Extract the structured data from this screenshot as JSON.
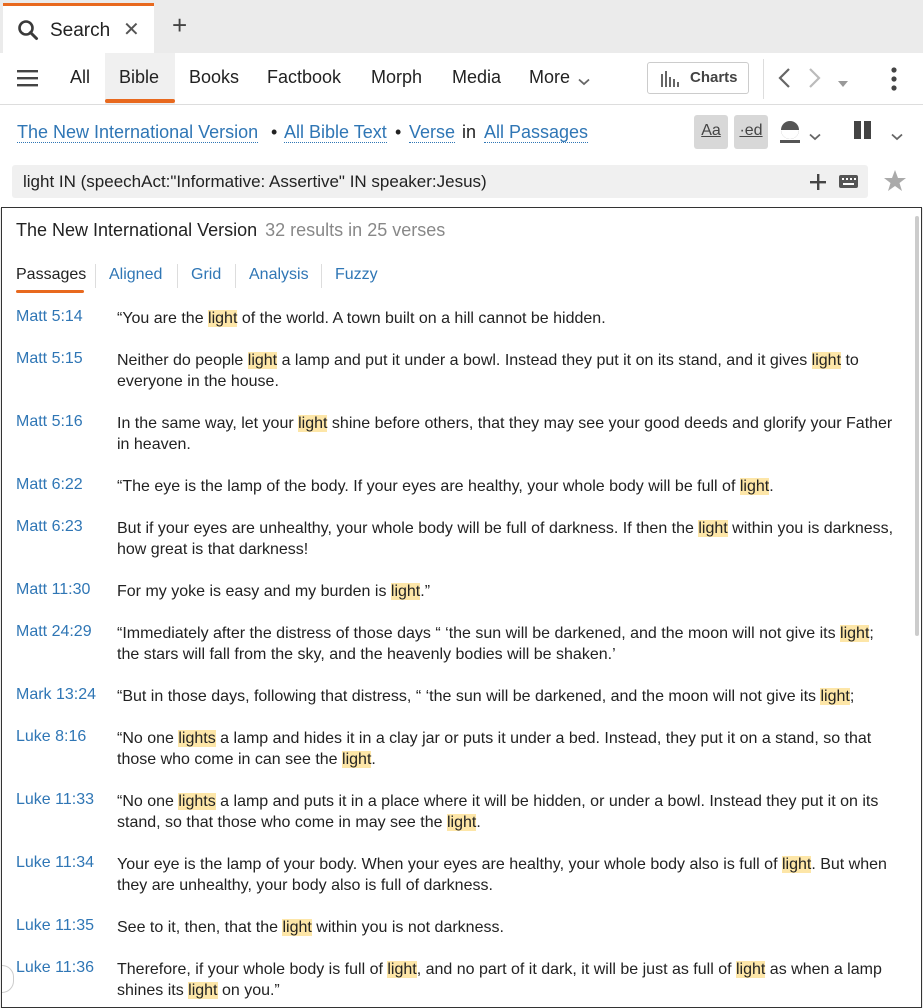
{
  "tab": {
    "label": "Search",
    "close": "✕",
    "new_tab": "+"
  },
  "toolbar": {
    "tabs": [
      "All",
      "Bible",
      "Books",
      "Factbook",
      "Morph",
      "Media",
      "More"
    ],
    "charts_label": "Charts"
  },
  "breadcrumbs": {
    "version": "The New International Version",
    "scope": "All Bible Text",
    "unit": "Verse",
    "in_label": "in",
    "passages": "All Passages",
    "aa_label": "Aa",
    "ed_label": "·ed"
  },
  "search": {
    "query": "light IN (speechAct:\"Informative: Assertive\" IN speaker:Jesus)"
  },
  "panel": {
    "title": "The New International Version",
    "count": "32 results in 25 verses",
    "subtabs": [
      "Passages",
      "Aligned",
      "Grid",
      "Analysis",
      "Fuzzy"
    ]
  },
  "results": [
    {
      "ref": "Matt 5:14",
      "parts": [
        [
          "“You are the ",
          0
        ],
        [
          "light",
          1
        ],
        [
          " of the world. A town built on a hill cannot be hidden.",
          0
        ]
      ]
    },
    {
      "ref": "Matt 5:15",
      "parts": [
        [
          "Neither do people ",
          0
        ],
        [
          "light",
          1
        ],
        [
          " a lamp and put it under a bowl. Instead they put it on its stand, and it gives ",
          0
        ],
        [
          "light",
          1
        ],
        [
          " to everyone in the house.",
          0
        ]
      ]
    },
    {
      "ref": "Matt 5:16",
      "parts": [
        [
          "In the same way, let your ",
          0
        ],
        [
          "light",
          1
        ],
        [
          " shine before others, that they may see your good deeds and glorify your Father in heaven.",
          0
        ]
      ]
    },
    {
      "ref": "Matt 6:22",
      "parts": [
        [
          "“The eye is the lamp of the body. If your eyes are healthy, your whole body will be full of ",
          0
        ],
        [
          "light",
          1
        ],
        [
          ".",
          0
        ]
      ]
    },
    {
      "ref": "Matt 6:23",
      "parts": [
        [
          "But if your eyes are unhealthy, your whole body will be full of darkness. If then the ",
          0
        ],
        [
          "light",
          1
        ],
        [
          " within you is darkness, how great is that darkness!",
          0
        ]
      ]
    },
    {
      "ref": "Matt 11:30",
      "parts": [
        [
          "For my yoke is easy and my burden is ",
          0
        ],
        [
          "light",
          1
        ],
        [
          ".”",
          0
        ]
      ]
    },
    {
      "ref": "Matt 24:29",
      "parts": [
        [
          "“Immediately after the distress of those days “ ‘the sun will be darkened, and the moon will not give its ",
          0
        ],
        [
          "light",
          1
        ],
        [
          "; the stars will fall from the sky, and the heavenly bodies will be shaken.’",
          0
        ]
      ]
    },
    {
      "ref": "Mark 13:24",
      "parts": [
        [
          "“But in those days, following that distress, “ ‘the sun will be darkened, and the moon will not give its ",
          0
        ],
        [
          "light",
          1
        ],
        [
          ";",
          0
        ]
      ]
    },
    {
      "ref": "Luke 8:16",
      "parts": [
        [
          "“No one ",
          0
        ],
        [
          "lights",
          1
        ],
        [
          " a lamp and hides it in a clay jar or puts it under a bed. Instead, they put it on a stand, so that those who come in can see the ",
          0
        ],
        [
          "light",
          1
        ],
        [
          ".",
          0
        ]
      ]
    },
    {
      "ref": "Luke 11:33",
      "parts": [
        [
          "“No one ",
          0
        ],
        [
          "lights",
          1
        ],
        [
          " a lamp and puts it in a place where it will be hidden, or under a bowl. Instead they put it on its stand, so that those who come in may see the ",
          0
        ],
        [
          "light",
          1
        ],
        [
          ".",
          0
        ]
      ]
    },
    {
      "ref": "Luke 11:34",
      "parts": [
        [
          "Your eye is the lamp of your body. When your eyes are healthy, your whole body also is full of ",
          0
        ],
        [
          "light",
          1
        ],
        [
          ". But when they are unhealthy, your body also is full of darkness.",
          0
        ]
      ]
    },
    {
      "ref": "Luke 11:35",
      "parts": [
        [
          "See to it, then, that the ",
          0
        ],
        [
          "light",
          1
        ],
        [
          " within you is not darkness.",
          0
        ]
      ]
    },
    {
      "ref": "Luke 11:36",
      "parts": [
        [
          "Therefore, if your whole body is full of ",
          0
        ],
        [
          "light",
          1
        ],
        [
          ", and no part of it dark, it will be just as full of ",
          0
        ],
        [
          "light",
          1
        ],
        [
          " as when a lamp shines its ",
          0
        ],
        [
          "light",
          1
        ],
        [
          " on you.”",
          0
        ]
      ]
    }
  ]
}
